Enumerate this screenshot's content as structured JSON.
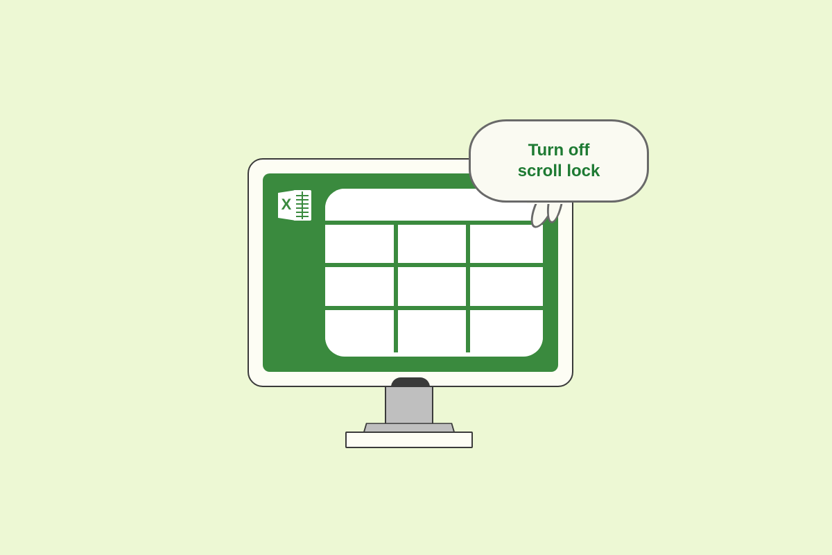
{
  "bubble": {
    "text": "Turn off\nscroll lock"
  },
  "icon": {
    "name": "excel-icon"
  },
  "colors": {
    "background": "#edf8d4",
    "screen": "#3a8a3e",
    "bubble_text": "#1e7a33",
    "bubble_border": "#696969"
  }
}
